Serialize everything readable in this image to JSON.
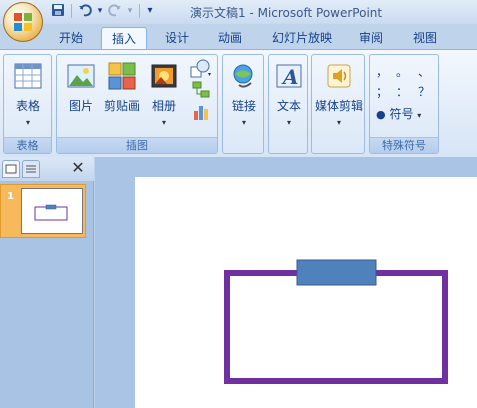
{
  "window": {
    "title": "演示文稿1 - Microsoft PowerPoint"
  },
  "qat": {
    "icons": [
      "save-icon",
      "undo-icon",
      "redo-icon",
      "customize-icon"
    ],
    "undo_drop": "▾",
    "redo_drop": "▾",
    "customize": "▾"
  },
  "tabs": [
    {
      "label": "开始",
      "active": false
    },
    {
      "label": "插入",
      "active": true
    },
    {
      "label": "设计",
      "active": false
    },
    {
      "label": "动画",
      "active": false
    },
    {
      "label": "幻灯片放映",
      "active": false
    },
    {
      "label": "审阅",
      "active": false
    },
    {
      "label": "视图",
      "active": false
    }
  ],
  "ribbon": {
    "groups": {
      "table": {
        "label": "表格",
        "button": "表格"
      },
      "images": {
        "label": "插图",
        "picture": "图片",
        "clipart": "剪贴画",
        "album": "相册"
      },
      "links": {
        "button": "链接"
      },
      "text": {
        "button": "文本"
      },
      "media": {
        "button": "媒体剪辑"
      },
      "symbols": {
        "label": "特殊符号",
        "button": "符号",
        "chars": [
          "，",
          "。",
          "、",
          "；",
          "：",
          "？"
        ]
      }
    }
  },
  "slides_pane": {
    "close": "✕",
    "thumbnail_number": "1"
  },
  "colors": {
    "shape_stroke": "#7030a0",
    "shape_fill": "#4f81bd",
    "selected_thumb": "#f6b95c"
  }
}
